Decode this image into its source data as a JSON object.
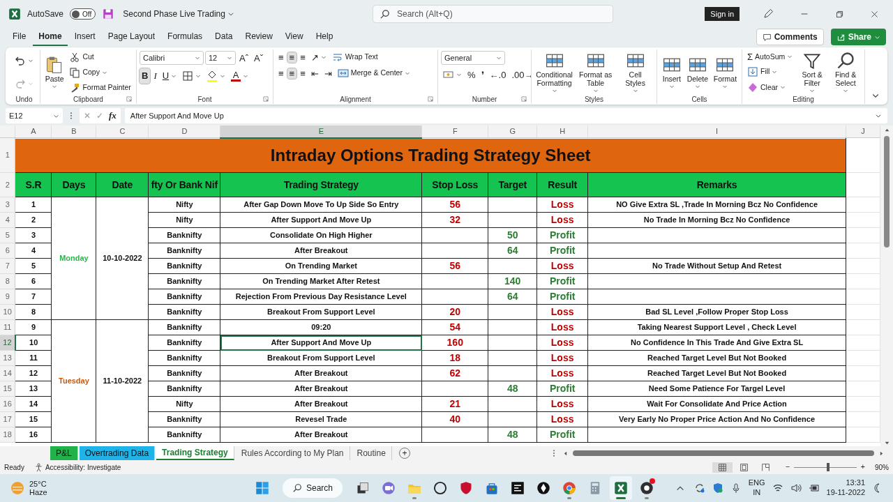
{
  "title_bar": {
    "autosave_label": "AutoSave",
    "autosave": {
      "on": false,
      "text": "Off"
    },
    "document_title": "Second Phase Live Trading",
    "search_placeholder": "Search (Alt+Q)",
    "sign_in": "Sign in"
  },
  "menu": {
    "tabs": [
      {
        "label": "File",
        "selected": false
      },
      {
        "label": "Home",
        "selected": true
      },
      {
        "label": "Insert",
        "selected": false
      },
      {
        "label": "Page Layout",
        "selected": false
      },
      {
        "label": "Formulas",
        "selected": false
      },
      {
        "label": "Data",
        "selected": false
      },
      {
        "label": "Review",
        "selected": false
      },
      {
        "label": "View",
        "selected": false
      },
      {
        "label": "Help",
        "selected": false
      }
    ],
    "comments": "Comments",
    "share": "Share"
  },
  "ribbon": {
    "groups": [
      {
        "label": "Undo",
        "stacks": [
          {
            "items": [
              {
                "kind": "undo",
                "dropdown": true,
                "disabled": false
              },
              {
                "kind": "redo",
                "dropdown": true,
                "disabled": true
              }
            ]
          }
        ]
      },
      {
        "label": "Clipboard",
        "launcher": true,
        "stacks": [
          {
            "items": [
              {
                "kind": "paste",
                "label": "Paste",
                "dropdown": true
              }
            ]
          },
          {
            "items": [
              {
                "kind": "cut",
                "label": "Cut"
              },
              {
                "kind": "copy",
                "label": "Copy",
                "dropdown": true
              },
              {
                "kind": "painter",
                "label": "Format Painter"
              }
            ]
          }
        ]
      },
      {
        "label": "Font",
        "launcher": true,
        "lines": [
          {
            "items": [
              {
                "kind": "select",
                "value": "Calibri"
              },
              {
                "kind": "select",
                "value": "12"
              },
              {
                "kind": "glyph",
                "glyph": "Aˆ"
              },
              {
                "kind": "glyph",
                "glyph": "Aˇ"
              }
            ]
          },
          {
            "items": [
              {
                "kind": "bold",
                "glyph": "B",
                "selected": true
              },
              {
                "kind": "italic",
                "glyph": "I",
                "selected": false
              },
              {
                "kind": "underline",
                "glyph": "U",
                "selected": false,
                "dropdown": true
              },
              {
                "kind": "borders",
                "dropdown": true
              },
              {
                "kind": "fill-color",
                "dropdown": true
              },
              {
                "kind": "font-color",
                "glyph": "A",
                "dropdown": true
              }
            ]
          }
        ]
      },
      {
        "label": "Alignment",
        "launcher": true,
        "lines": [
          {
            "items": [
              {
                "kind": "glyph",
                "glyph": "≡",
                "selected": false
              },
              {
                "kind": "glyph",
                "glyph": "≡",
                "selected": true
              },
              {
                "kind": "glyph",
                "glyph": "≡",
                "selected": false
              },
              {
                "kind": "glyph",
                "glyph": "↗",
                "dropdown": true
              },
              {
                "kind": "wrap",
                "label": "Wrap Text"
              }
            ]
          },
          {
            "items": [
              {
                "kind": "glyph",
                "glyph": "≡",
                "selected": false
              },
              {
                "kind": "glyph",
                "glyph": "≡",
                "selected": true
              },
              {
                "kind": "glyph",
                "glyph": "≡",
                "selected": false
              },
              {
                "kind": "glyph",
                "glyph": "⇤"
              },
              {
                "kind": "glyph",
                "glyph": "⇥"
              },
              {
                "kind": "merge",
                "label": "Merge & Center",
                "dropdown": true
              }
            ]
          }
        ]
      },
      {
        "label": "Number",
        "launcher": true,
        "lines": [
          {
            "items": [
              {
                "kind": "select",
                "value": "General"
              }
            ]
          },
          {
            "items": [
              {
                "kind": "currency",
                "dropdown": true
              },
              {
                "kind": "glyph",
                "glyph": "%"
              },
              {
                "kind": "glyph",
                "glyph": "❜"
              },
              {
                "kind": "glyph",
                "glyph": "←.0"
              },
              {
                "kind": "glyph",
                "glyph": ".00→"
              }
            ]
          }
        ]
      },
      {
        "label": "Styles",
        "stacks": [
          {
            "items": [
              {
                "kind": "gallery",
                "label": "Conditional Formatting",
                "dropdown": true
              }
            ]
          },
          {
            "items": [
              {
                "kind": "gallery",
                "label": "Format as Table",
                "dropdown": true
              }
            ]
          },
          {
            "items": [
              {
                "kind": "gallery",
                "label": "Cell Styles",
                "dropdown": true
              }
            ]
          }
        ]
      },
      {
        "label": "Cells",
        "stacks": [
          {
            "items": [
              {
                "kind": "gallery",
                "label": "Insert",
                "dropdown": true
              }
            ]
          },
          {
            "items": [
              {
                "kind": "gallery",
                "label": "Delete",
                "dropdown": true
              }
            ]
          },
          {
            "items": [
              {
                "kind": "gallery",
                "label": "Format",
                "dropdown": true
              }
            ]
          }
        ]
      },
      {
        "label": "Editing",
        "stacks": [
          {
            "items": [
              {
                "kind": "autosum",
                "glyph": "Σ",
                "label": "AutoSum",
                "dropdown": true
              },
              {
                "kind": "fill",
                "label": "Fill",
                "dropdown": true
              },
              {
                "kind": "clear",
                "label": "Clear",
                "dropdown": true
              }
            ]
          },
          {
            "items": [
              {
                "kind": "sort",
                "label": "Sort & Filter",
                "dropdown": true
              }
            ]
          },
          {
            "items": [
              {
                "kind": "find",
                "label": "Find & Select",
                "dropdown": true
              }
            ]
          }
        ]
      }
    ]
  },
  "formula_bar": {
    "name_box": "E12",
    "cancel": "✕",
    "enter": "✓",
    "fx": "fx",
    "formula": "After Support And Move Up"
  },
  "columns": [
    {
      "letter": "A",
      "selected": false
    },
    {
      "letter": "B",
      "selected": false
    },
    {
      "letter": "C",
      "selected": false
    },
    {
      "letter": "D",
      "selected": false
    },
    {
      "letter": "E",
      "selected": true
    },
    {
      "letter": "F",
      "selected": false
    },
    {
      "letter": "G",
      "selected": false
    },
    {
      "letter": "H",
      "selected": false
    },
    {
      "letter": "I",
      "selected": false
    },
    {
      "letter": "J",
      "selected": false
    }
  ],
  "sheet": {
    "title_row": {
      "row": "1",
      "text": "Intraday  Options Trading Strategy  Sheet"
    },
    "header_row": {
      "row": "2",
      "headers": [
        "S.R",
        "Days",
        "Date",
        "fty Or Bank Nif",
        "Trading Strategy",
        "Stop Loss",
        "Target",
        "Result",
        "Remarks"
      ]
    },
    "days": [
      {
        "day": "Monday",
        "date": "10-10-2022",
        "color": "#2db34a",
        "rows": [
          {
            "row": "3",
            "sr": "1",
            "symbol": "Nifty",
            "strategy": "After Gap Down Move To Up Side So Entry",
            "stop_loss": "56",
            "result": "Loss",
            "kind": "loss",
            "remark": "NO Give Extra SL ,Trade In Morning  Bcz No Confidence",
            "selected": false
          },
          {
            "row": "4",
            "sr": "2",
            "symbol": "Nifty",
            "strategy": "After Support And Move Up",
            "stop_loss": "32",
            "result": "Loss",
            "kind": "loss",
            "remark": "No Trade In Morning  Bcz No Confidence",
            "selected": false
          },
          {
            "row": "5",
            "sr": "3",
            "symbol": "Banknifty",
            "strategy": "Consolidate On High Higher",
            "target": "50",
            "result": "Profit",
            "kind": "profit",
            "selected": false
          },
          {
            "row": "6",
            "sr": "4",
            "symbol": "Banknifty",
            "strategy": "After Breakout",
            "target": "64",
            "result": "Profit",
            "kind": "profit",
            "selected": false
          },
          {
            "row": "7",
            "sr": "5",
            "symbol": "Banknifty",
            "strategy": "On Trending Market",
            "stop_loss": "56",
            "result": "Loss",
            "kind": "loss",
            "remark": "No Trade Without Setup And Retest",
            "selected": false
          },
          {
            "row": "8",
            "sr": "6",
            "symbol": "Banknifty",
            "strategy": "On Trending Market  After Retest",
            "target": "140",
            "result": "Profit",
            "kind": "profit",
            "selected": false
          },
          {
            "row": "9",
            "sr": "7",
            "symbol": "Banknifty",
            "strategy": "Rejection From Previous Day Resistance Level",
            "target": "64",
            "result": "Profit",
            "kind": "profit",
            "selected": false
          },
          {
            "row": "10",
            "sr": "8",
            "symbol": "Banknifty",
            "strategy": "Breakout From Support Level",
            "stop_loss": "20",
            "result": "Loss",
            "kind": "loss",
            "remark": "Bad SL Level ,Follow  Proper Stop Loss",
            "selected": false
          }
        ]
      },
      {
        "day": "Tuesday",
        "date": "11-10-2022",
        "color": "#c55a11",
        "rows": [
          {
            "row": "11",
            "sr": "9",
            "symbol": "Banknifty",
            "strategy": "09:20",
            "stop_loss": "54",
            "result": "Loss",
            "kind": "loss",
            "remark": "Taking Nearest Support Level , Check Level",
            "selected": false
          },
          {
            "row": "12",
            "sr": "10",
            "symbol": "Banknifty",
            "strategy": "After Support And Move Up",
            "stop_loss": "160",
            "result": "Loss",
            "kind": "loss",
            "remark": "No Confidence In This Trade And Give Extra SL",
            "selected": true
          },
          {
            "row": "13",
            "sr": "11",
            "symbol": "Banknifty",
            "strategy": "Breakout From Support Level",
            "stop_loss": "18",
            "result": "Loss",
            "kind": "loss",
            "remark": "Reached Target Level But Not Booked",
            "selected": false
          },
          {
            "row": "14",
            "sr": "12",
            "symbol": "Banknifty",
            "strategy": "After Breakout",
            "stop_loss": "62",
            "result": "Loss",
            "kind": "loss",
            "remark": "Reached Target Level But Not Booked",
            "selected": false
          },
          {
            "row": "15",
            "sr": "13",
            "symbol": "Banknifty",
            "strategy": "After Breakout",
            "target": "48",
            "result": "Profit",
            "kind": "profit",
            "remark": "Need Some Patience For Targel Level",
            "selected": false
          },
          {
            "row": "16",
            "sr": "14",
            "symbol": "Nifty",
            "strategy": "After Breakout",
            "stop_loss": "21",
            "result": "Loss",
            "kind": "loss",
            "remark": "Wait For Consolidate  And Price Action",
            "selected": false
          },
          {
            "row": "17",
            "sr": "15",
            "symbol": "Banknifty",
            "strategy": "Revesel Trade",
            "stop_loss": "40",
            "result": "Loss",
            "kind": "loss",
            "remark": "Very Early No Proper Price Action And No Confidence",
            "selected": false
          },
          {
            "row": "18",
            "sr": "16",
            "symbol": "Banknifty",
            "strategy": "After Breakout",
            "target": "48",
            "result": "Profit",
            "kind": "profit",
            "selected": false
          }
        ]
      }
    ]
  },
  "sheet_tabs": [
    {
      "label": "P&L",
      "color": "#21b24b",
      "selected": false
    },
    {
      "label": "Overtrading Data",
      "color": "#1fb3e8",
      "selected": false
    },
    {
      "label": "Trading Strategy",
      "selected": true
    },
    {
      "label": "Rules According to My Plan",
      "selected": false
    },
    {
      "label": "Routine",
      "selected": false
    }
  ],
  "add_sheet": "+",
  "status_bar": {
    "ready": "Ready",
    "accessibility": "Accessibility: Investigate",
    "views": [
      {
        "selected": true
      },
      {
        "selected": false
      },
      {
        "selected": false
      }
    ],
    "zoom_out": "−",
    "zoom_in": "+",
    "zoom": {
      "level": 0.55
    },
    "zoom_text": "90%"
  },
  "taskbar": {
    "weather": {
      "temperature": "25°C",
      "condition": "Haze"
    },
    "search": "Search",
    "apps": [
      {
        "kind": "start",
        "running": false,
        "active": false
      },
      {
        "kind": "search"
      },
      {
        "kind": "task-view",
        "running": false,
        "active": false
      },
      {
        "kind": "chat",
        "running": false,
        "active": false
      },
      {
        "kind": "folder",
        "running": true,
        "active": false
      },
      {
        "kind": "circle-logo",
        "running": false,
        "active": false
      },
      {
        "kind": "shield",
        "running": false,
        "active": false
      },
      {
        "kind": "store",
        "running": false,
        "active": false
      },
      {
        "kind": "tile",
        "running": false,
        "active": false
      },
      {
        "kind": "pen-nib",
        "running": false,
        "active": false
      },
      {
        "kind": "browser",
        "running": true,
        "active": false
      },
      {
        "kind": "calculator",
        "running": false,
        "active": false
      },
      {
        "kind": "spreadsheet",
        "running": true,
        "active": true
      },
      {
        "kind": "record",
        "running": true,
        "active": false,
        "notification": true
      }
    ],
    "language": "ENG",
    "region": "IN",
    "time": "13:31",
    "date": "19-11-2022"
  }
}
